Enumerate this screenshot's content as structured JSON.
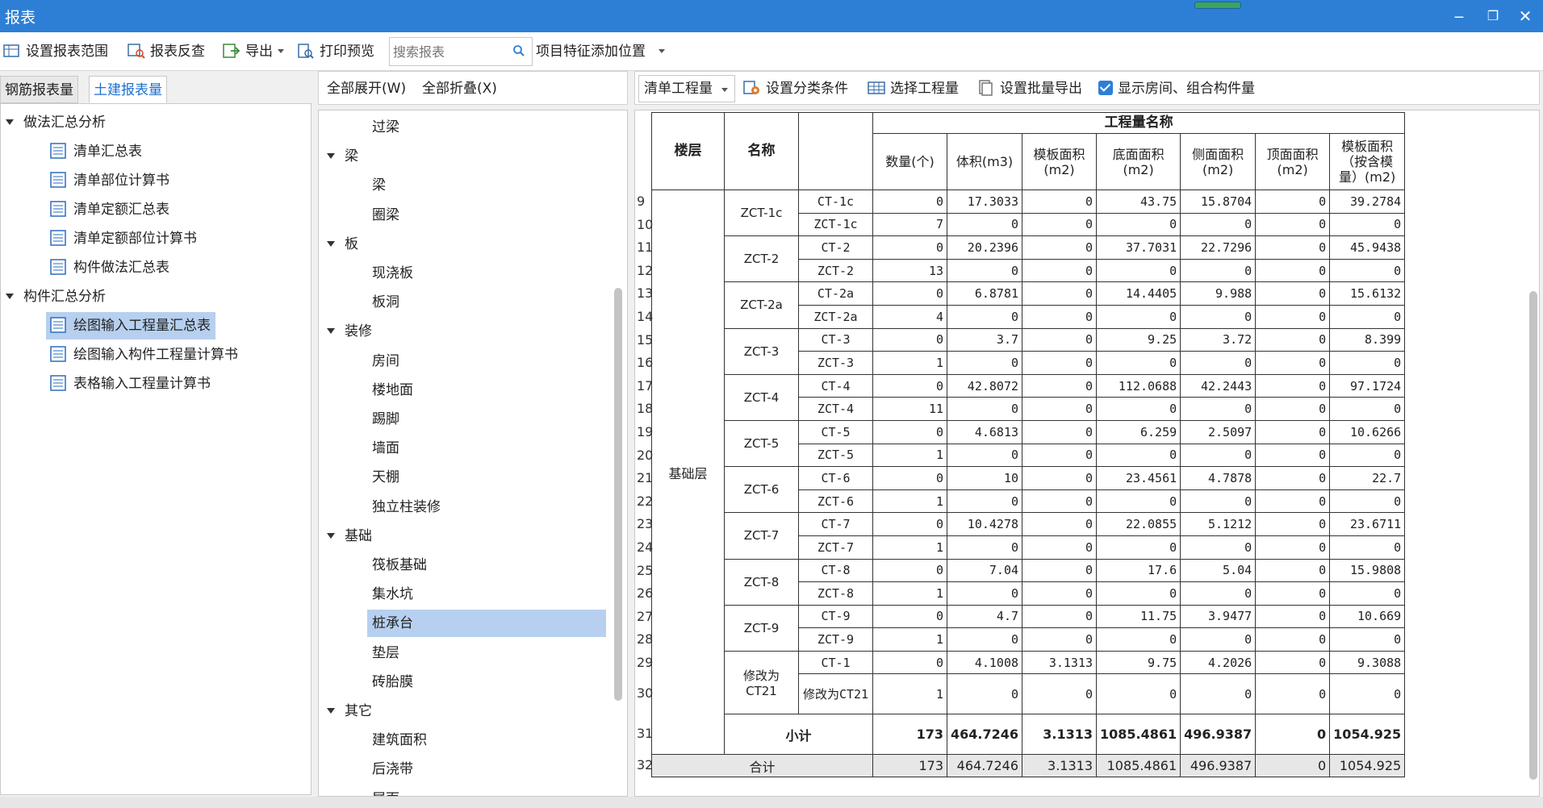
{
  "window": {
    "title": "报表",
    "minimize": "‒",
    "restore": "❐",
    "close": "✕"
  },
  "toolbar": {
    "set_range": "设置报表范围",
    "report_check": "报表反查",
    "export": "导出",
    "print_preview": "打印预览",
    "search_placeholder": "搜索报表",
    "feature_position": "项目特征添加位置"
  },
  "left": {
    "tabs": [
      "钢筋报表量",
      "土建报表量"
    ],
    "active_tab": 1,
    "groups": [
      {
        "label": "做法汇总分析",
        "items": [
          "清单汇总表",
          "清单部位计算书",
          "清单定额汇总表",
          "清单定额部位计算书",
          "构件做法汇总表"
        ]
      },
      {
        "label": "构件汇总分析",
        "items": [
          "绘图输入工程量汇总表",
          "绘图输入构件工程量计算书",
          "表格输入工程量计算书"
        ]
      }
    ],
    "selected_item": "绘图输入工程量汇总表"
  },
  "middle": {
    "expand_all": "全部展开(W)",
    "collapse_all": "全部折叠(X)",
    "entries": [
      {
        "type": "leaf",
        "label": "过梁"
      },
      {
        "type": "group",
        "label": "梁"
      },
      {
        "type": "leaf",
        "label": "梁"
      },
      {
        "type": "leaf",
        "label": "圈梁"
      },
      {
        "type": "group",
        "label": "板"
      },
      {
        "type": "leaf",
        "label": "现浇板"
      },
      {
        "type": "leaf",
        "label": "板洞"
      },
      {
        "type": "group",
        "label": "装修"
      },
      {
        "type": "leaf",
        "label": "房间"
      },
      {
        "type": "leaf",
        "label": "楼地面"
      },
      {
        "type": "leaf",
        "label": "踢脚"
      },
      {
        "type": "leaf",
        "label": "墙面"
      },
      {
        "type": "leaf",
        "label": "天棚"
      },
      {
        "type": "leaf",
        "label": "独立柱装修"
      },
      {
        "type": "group",
        "label": "基础"
      },
      {
        "type": "leaf",
        "label": "筏板基础"
      },
      {
        "type": "leaf",
        "label": "集水坑"
      },
      {
        "type": "leaf",
        "label": "桩承台",
        "selected": true
      },
      {
        "type": "leaf",
        "label": "垫层"
      },
      {
        "type": "leaf",
        "label": "砖胎膜"
      },
      {
        "type": "group",
        "label": "其它"
      },
      {
        "type": "leaf",
        "label": "建筑面积"
      },
      {
        "type": "leaf",
        "label": "后浇带"
      },
      {
        "type": "leaf",
        "label": "尾面"
      }
    ]
  },
  "right_toolbar": {
    "qty_type": "清单工程量",
    "set_classify": "设置分类条件",
    "select_qty": "选择工程量",
    "batch_export": "设置批量导出",
    "show_room": "显示房间、组合构件量"
  },
  "report": {
    "header": {
      "floor": "楼层",
      "name": "名称",
      "qty_name": "工程量名称",
      "cols": [
        "数量(个)",
        "体积(m3)",
        "模板面积(m2)",
        "底面面积(m2)",
        "侧面面积(m2)",
        "顶面面积(m2)",
        "模板面积（按含模量）(m2)"
      ]
    },
    "floor_name": "基础层",
    "groups": [
      {
        "name": "ZCT-1c",
        "rows": [
          {
            "n": 9,
            "sub": "CT-1c",
            "v": [
              "0",
              "17.3033",
              "0",
              "43.75",
              "15.8704",
              "0",
              "39.2784"
            ]
          },
          {
            "n": 10,
            "sub": "ZCT-1c",
            "v": [
              "7",
              "0",
              "0",
              "0",
              "0",
              "0",
              "0"
            ]
          }
        ]
      },
      {
        "name": "ZCT-2",
        "rows": [
          {
            "n": 11,
            "sub": "CT-2",
            "v": [
              "0",
              "20.2396",
              "0",
              "37.7031",
              "22.7296",
              "0",
              "45.9438"
            ]
          },
          {
            "n": 12,
            "sub": "ZCT-2",
            "v": [
              "13",
              "0",
              "0",
              "0",
              "0",
              "0",
              "0"
            ]
          }
        ]
      },
      {
        "name": "ZCT-2a",
        "rows": [
          {
            "n": 13,
            "sub": "CT-2a",
            "v": [
              "0",
              "6.8781",
              "0",
              "14.4405",
              "9.988",
              "0",
              "15.6132"
            ]
          },
          {
            "n": 14,
            "sub": "ZCT-2a",
            "v": [
              "4",
              "0",
              "0",
              "0",
              "0",
              "0",
              "0"
            ]
          }
        ]
      },
      {
        "name": "ZCT-3",
        "rows": [
          {
            "n": 15,
            "sub": "CT-3",
            "v": [
              "0",
              "3.7",
              "0",
              "9.25",
              "3.72",
              "0",
              "8.399"
            ]
          },
          {
            "n": 16,
            "sub": "ZCT-3",
            "v": [
              "1",
              "0",
              "0",
              "0",
              "0",
              "0",
              "0"
            ]
          }
        ]
      },
      {
        "name": "ZCT-4",
        "rows": [
          {
            "n": 17,
            "sub": "CT-4",
            "v": [
              "0",
              "42.8072",
              "0",
              "112.0688",
              "42.2443",
              "0",
              "97.1724"
            ]
          },
          {
            "n": 18,
            "sub": "ZCT-4",
            "v": [
              "11",
              "0",
              "0",
              "0",
              "0",
              "0",
              "0"
            ]
          }
        ]
      },
      {
        "name": "ZCT-5",
        "rows": [
          {
            "n": 19,
            "sub": "CT-5",
            "v": [
              "0",
              "4.6813",
              "0",
              "6.259",
              "2.5097",
              "0",
              "10.6266"
            ]
          },
          {
            "n": 20,
            "sub": "ZCT-5",
            "v": [
              "1",
              "0",
              "0",
              "0",
              "0",
              "0",
              "0"
            ]
          }
        ]
      },
      {
        "name": "ZCT-6",
        "rows": [
          {
            "n": 21,
            "sub": "CT-6",
            "v": [
              "0",
              "10",
              "0",
              "23.4561",
              "4.7878",
              "0",
              "22.7"
            ]
          },
          {
            "n": 22,
            "sub": "ZCT-6",
            "v": [
              "1",
              "0",
              "0",
              "0",
              "0",
              "0",
              "0"
            ]
          }
        ]
      },
      {
        "name": "ZCT-7",
        "rows": [
          {
            "n": 23,
            "sub": "CT-7",
            "v": [
              "0",
              "10.4278",
              "0",
              "22.0855",
              "5.1212",
              "0",
              "23.6711"
            ]
          },
          {
            "n": 24,
            "sub": "ZCT-7",
            "v": [
              "1",
              "0",
              "0",
              "0",
              "0",
              "0",
              "0"
            ]
          }
        ]
      },
      {
        "name": "ZCT-8",
        "rows": [
          {
            "n": 25,
            "sub": "CT-8",
            "v": [
              "0",
              "7.04",
              "0",
              "17.6",
              "5.04",
              "0",
              "15.9808"
            ]
          },
          {
            "n": 26,
            "sub": "ZCT-8",
            "v": [
              "1",
              "0",
              "0",
              "0",
              "0",
              "0",
              "0"
            ]
          }
        ]
      },
      {
        "name": "ZCT-9",
        "rows": [
          {
            "n": 27,
            "sub": "CT-9",
            "v": [
              "0",
              "4.7",
              "0",
              "11.75",
              "3.9477",
              "0",
              "10.669"
            ]
          },
          {
            "n": 28,
            "sub": "ZCT-9",
            "v": [
              "1",
              "0",
              "0",
              "0",
              "0",
              "0",
              "0"
            ]
          }
        ]
      },
      {
        "name": "修改为CT21",
        "rows": [
          {
            "n": 29,
            "sub": "CT-1",
            "v": [
              "0",
              "4.1008",
              "3.1313",
              "9.75",
              "4.2026",
              "0",
              "9.3088"
            ]
          },
          {
            "n": 30,
            "sub": "修改为CT21",
            "v": [
              "1",
              "0",
              "0",
              "0",
              "0",
              "0",
              "0"
            ]
          }
        ]
      }
    ],
    "subtotal": {
      "n": 31,
      "label": "小计",
      "v": [
        "173",
        "464.7246",
        "3.1313",
        "1085.4861",
        "496.9387",
        "0",
        "1054.925"
      ]
    },
    "total": {
      "n": 32,
      "label": "合计",
      "v": [
        "173",
        "464.7246",
        "3.1313",
        "1085.4861",
        "496.9387",
        "0",
        "1054.925"
      ]
    }
  }
}
